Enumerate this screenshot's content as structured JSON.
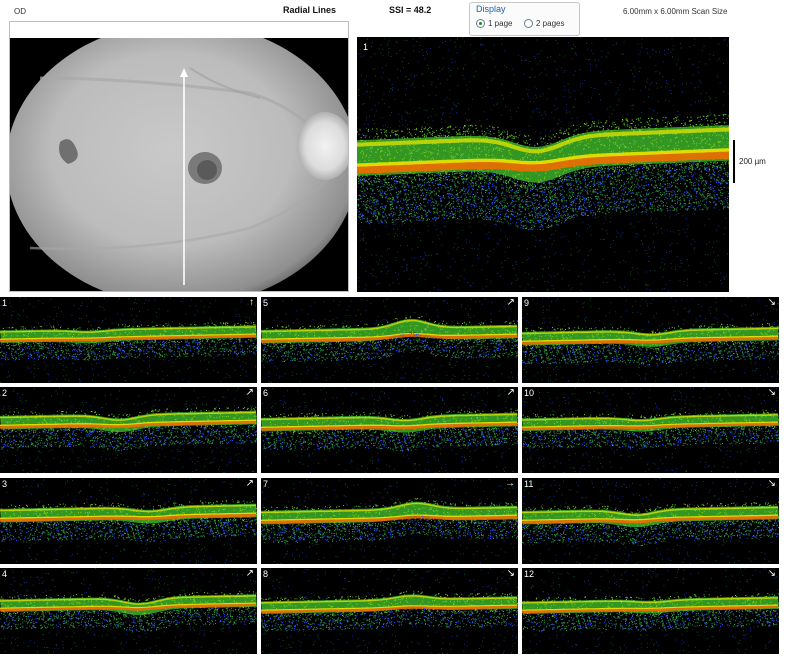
{
  "header": {
    "eye": "OD",
    "scan_type": "Radial Lines",
    "ssi": "SSI = 48.2",
    "scan_size": "6.00mm x 6.00mm Scan Size"
  },
  "display": {
    "title": "Display",
    "options": [
      {
        "label": "1 page",
        "selected": true
      },
      {
        "label": "2 pages",
        "selected": false
      }
    ]
  },
  "main_scan": {
    "number": "1",
    "scale_label": "200 µm"
  },
  "thumbnails": [
    {
      "number": "1",
      "arrow": "↑"
    },
    {
      "number": "2",
      "arrow": "↗"
    },
    {
      "number": "3",
      "arrow": "↗"
    },
    {
      "number": "4",
      "arrow": "↗"
    },
    {
      "number": "5",
      "arrow": "↗"
    },
    {
      "number": "6",
      "arrow": "↗"
    },
    {
      "number": "7",
      "arrow": "→"
    },
    {
      "number": "8",
      "arrow": "↘"
    },
    {
      "number": "9",
      "arrow": "↘"
    },
    {
      "number": "10",
      "arrow": "↘"
    },
    {
      "number": "11",
      "arrow": "↘"
    },
    {
      "number": "12",
      "arrow": "↘"
    }
  ],
  "colors": {
    "retina_green": "#3cb028",
    "retina_yellow": "#e6e600",
    "retina_orange": "#f06a00",
    "noise_blue": "#2a4fff",
    "display_title": "#1f5fae"
  },
  "icons": {
    "radio_on": "radio-selected-icon",
    "radio_off": "radio-unselected-icon",
    "scan_direction": "arrow-icon"
  }
}
